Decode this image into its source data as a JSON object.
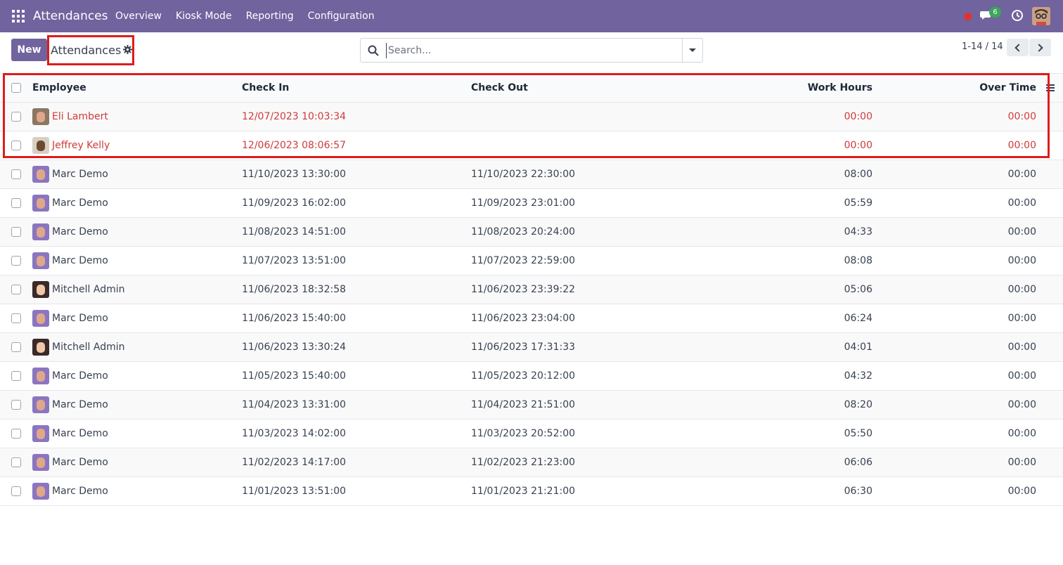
{
  "navbar": {
    "app_title": "Attendances",
    "menu": [
      "Overview",
      "Kiosk Mode",
      "Reporting",
      "Configuration"
    ],
    "message_count": "6"
  },
  "control": {
    "new_label": "New",
    "title": "Attendances",
    "search_placeholder": "Search...",
    "pager": "1-14 / 14"
  },
  "table": {
    "headers": {
      "employee": "Employee",
      "check_in": "Check In",
      "check_out": "Check Out",
      "work_hours": "Work Hours",
      "over_time": "Over Time"
    },
    "rows": [
      {
        "employee": "Eli Lambert",
        "check_in": "12/07/2023 10:03:34",
        "check_out": "",
        "work_hours": "00:00",
        "over_time": "00:00",
        "open": true,
        "avatar": "eli"
      },
      {
        "employee": "Jeffrey Kelly",
        "check_in": "12/06/2023 08:06:57",
        "check_out": "",
        "work_hours": "00:00",
        "over_time": "00:00",
        "open": true,
        "avatar": "jeffrey"
      },
      {
        "employee": "Marc Demo",
        "check_in": "11/10/2023 13:30:00",
        "check_out": "11/10/2023 22:30:00",
        "work_hours": "08:00",
        "over_time": "00:00",
        "open": false,
        "avatar": "marc"
      },
      {
        "employee": "Marc Demo",
        "check_in": "11/09/2023 16:02:00",
        "check_out": "11/09/2023 23:01:00",
        "work_hours": "05:59",
        "over_time": "00:00",
        "open": false,
        "avatar": "marc"
      },
      {
        "employee": "Marc Demo",
        "check_in": "11/08/2023 14:51:00",
        "check_out": "11/08/2023 20:24:00",
        "work_hours": "04:33",
        "over_time": "00:00",
        "open": false,
        "avatar": "marc"
      },
      {
        "employee": "Marc Demo",
        "check_in": "11/07/2023 13:51:00",
        "check_out": "11/07/2023 22:59:00",
        "work_hours": "08:08",
        "over_time": "00:00",
        "open": false,
        "avatar": "marc"
      },
      {
        "employee": "Mitchell Admin",
        "check_in": "11/06/2023 18:32:58",
        "check_out": "11/06/2023 23:39:22",
        "work_hours": "05:06",
        "over_time": "00:00",
        "open": false,
        "avatar": "mitchell"
      },
      {
        "employee": "Marc Demo",
        "check_in": "11/06/2023 15:40:00",
        "check_out": "11/06/2023 23:04:00",
        "work_hours": "06:24",
        "over_time": "00:00",
        "open": false,
        "avatar": "marc"
      },
      {
        "employee": "Mitchell Admin",
        "check_in": "11/06/2023 13:30:24",
        "check_out": "11/06/2023 17:31:33",
        "work_hours": "04:01",
        "over_time": "00:00",
        "open": false,
        "avatar": "mitchell"
      },
      {
        "employee": "Marc Demo",
        "check_in": "11/05/2023 15:40:00",
        "check_out": "11/05/2023 20:12:00",
        "work_hours": "04:32",
        "over_time": "00:00",
        "open": false,
        "avatar": "marc"
      },
      {
        "employee": "Marc Demo",
        "check_in": "11/04/2023 13:31:00",
        "check_out": "11/04/2023 21:51:00",
        "work_hours": "08:20",
        "over_time": "00:00",
        "open": false,
        "avatar": "marc"
      },
      {
        "employee": "Marc Demo",
        "check_in": "11/03/2023 14:02:00",
        "check_out": "11/03/2023 20:52:00",
        "work_hours": "05:50",
        "over_time": "00:00",
        "open": false,
        "avatar": "marc"
      },
      {
        "employee": "Marc Demo",
        "check_in": "11/02/2023 14:17:00",
        "check_out": "11/02/2023 21:23:00",
        "work_hours": "06:06",
        "over_time": "00:00",
        "open": false,
        "avatar": "marc"
      },
      {
        "employee": "Marc Demo",
        "check_in": "11/01/2023 13:51:00",
        "check_out": "11/01/2023 21:21:00",
        "work_hours": "06:30",
        "over_time": "00:00",
        "open": false,
        "avatar": "marc"
      }
    ]
  },
  "colors": {
    "navbar": "#71639e",
    "highlight": "#e01b1b",
    "open_record_text": "#cf3b3b"
  }
}
